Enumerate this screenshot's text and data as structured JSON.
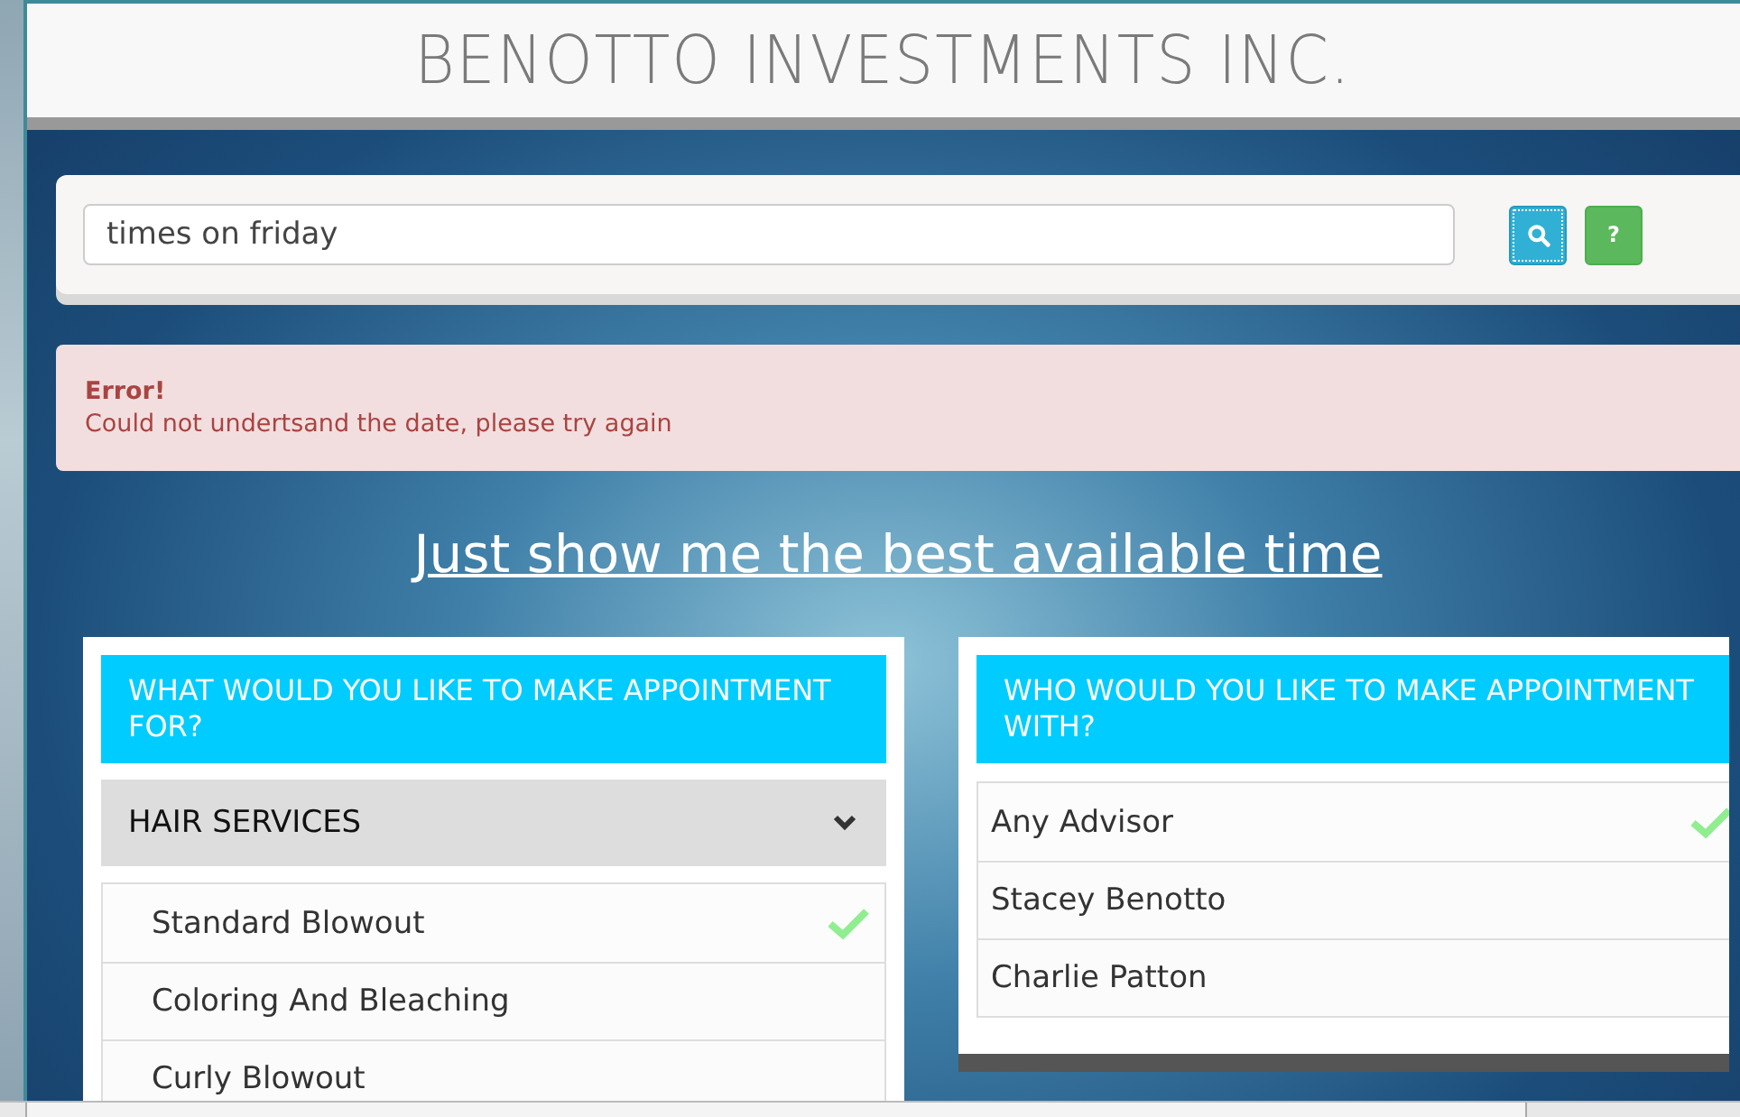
{
  "header": {
    "title": "BENOTTO INVESTMENTS INC."
  },
  "search": {
    "value": "times on friday",
    "search_button": {
      "focused": true
    },
    "help_button": {
      "label": "?"
    }
  },
  "alert": {
    "title": "Error!",
    "message": "Could not undertsand the date, please try again"
  },
  "best_time_link": "Just show me the best available time",
  "services_panel": {
    "heading": "WHAT WOULD YOU LIKE TO MAKE APPOINTMENT FOR?",
    "category": {
      "label": "HAIR SERVICES",
      "expanded": true
    },
    "items": [
      {
        "label": "Standard Blowout",
        "selected": true
      },
      {
        "label": "Coloring And Bleaching",
        "selected": false
      },
      {
        "label": "Curly Blowout",
        "selected": false
      }
    ]
  },
  "advisors_panel": {
    "heading": "WHO WOULD YOU LIKE TO MAKE APPOINTMENT WITH?",
    "items": [
      {
        "label": "Any Advisor",
        "selected": true
      },
      {
        "label": "Stacey Benotto",
        "selected": false
      },
      {
        "label": "Charlie Patton",
        "selected": false
      }
    ]
  }
}
